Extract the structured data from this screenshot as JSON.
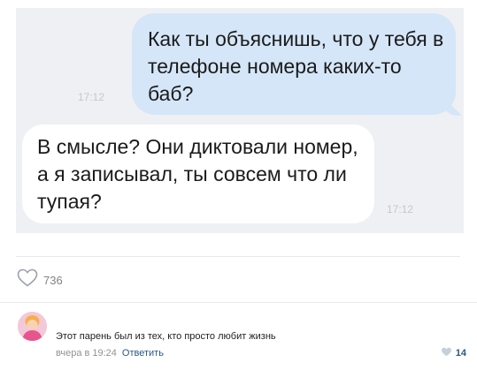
{
  "messages": {
    "outgoing": {
      "text": "Как ты объяснишь, что у тебя в телефоне номера каких-то баб?",
      "time": "17:12"
    },
    "incoming": {
      "text": "В смысле? Они диктовали номер, а я записывал, ты совсем что ли тупая?",
      "time": "17:12"
    }
  },
  "post": {
    "likes_count": "736",
    "like_icon": "heart-outline-icon"
  },
  "comment": {
    "text": "Этот парень был из тех, кто просто любит жизнь",
    "timestamp": "вчера в 19:24",
    "reply_label": "Ответить",
    "likes_count": "14"
  },
  "colors": {
    "chat_background": "#eef0f3",
    "outgoing_bubble": "#d5e6f8",
    "incoming_bubble": "#ffffff",
    "link": "#2a5885"
  }
}
